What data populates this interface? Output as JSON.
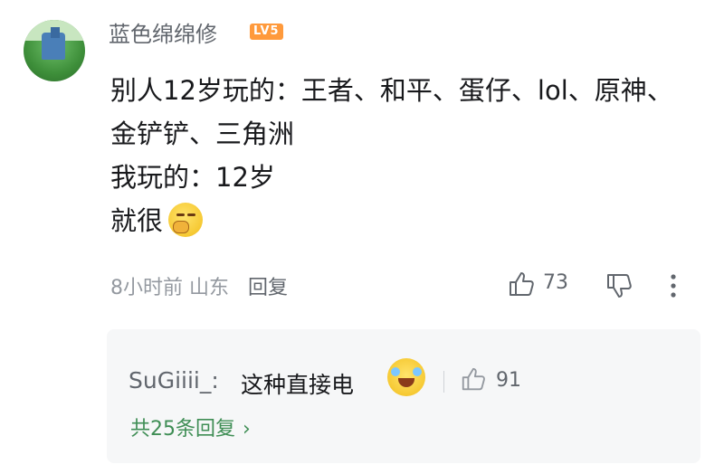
{
  "comment": {
    "username": "蓝色绵绵修",
    "level": "LV5",
    "lines": [
      "别人12岁玩的：王者、和平、蛋仔、lol、原神、",
      "金铲铲、三角洲",
      "我玩的：12岁",
      "就很"
    ],
    "time": "8小时前",
    "location": "山东",
    "reply_label": "回复",
    "like_count": "73"
  },
  "sub_reply": {
    "username": "SuGiiii_:",
    "text": "这种直接电",
    "like_count": "91",
    "view_more": "共25条回复"
  },
  "icons": {
    "like": "thumbs-up-icon",
    "dislike": "thumbs-down-icon",
    "more": "more-vertical-icon",
    "chevron": "chevron-right-icon"
  },
  "colors": {
    "level_badge": "#ff9a3c",
    "view_more_link": "#3f8e55",
    "reply_box_bg": "#f6f7f8"
  }
}
